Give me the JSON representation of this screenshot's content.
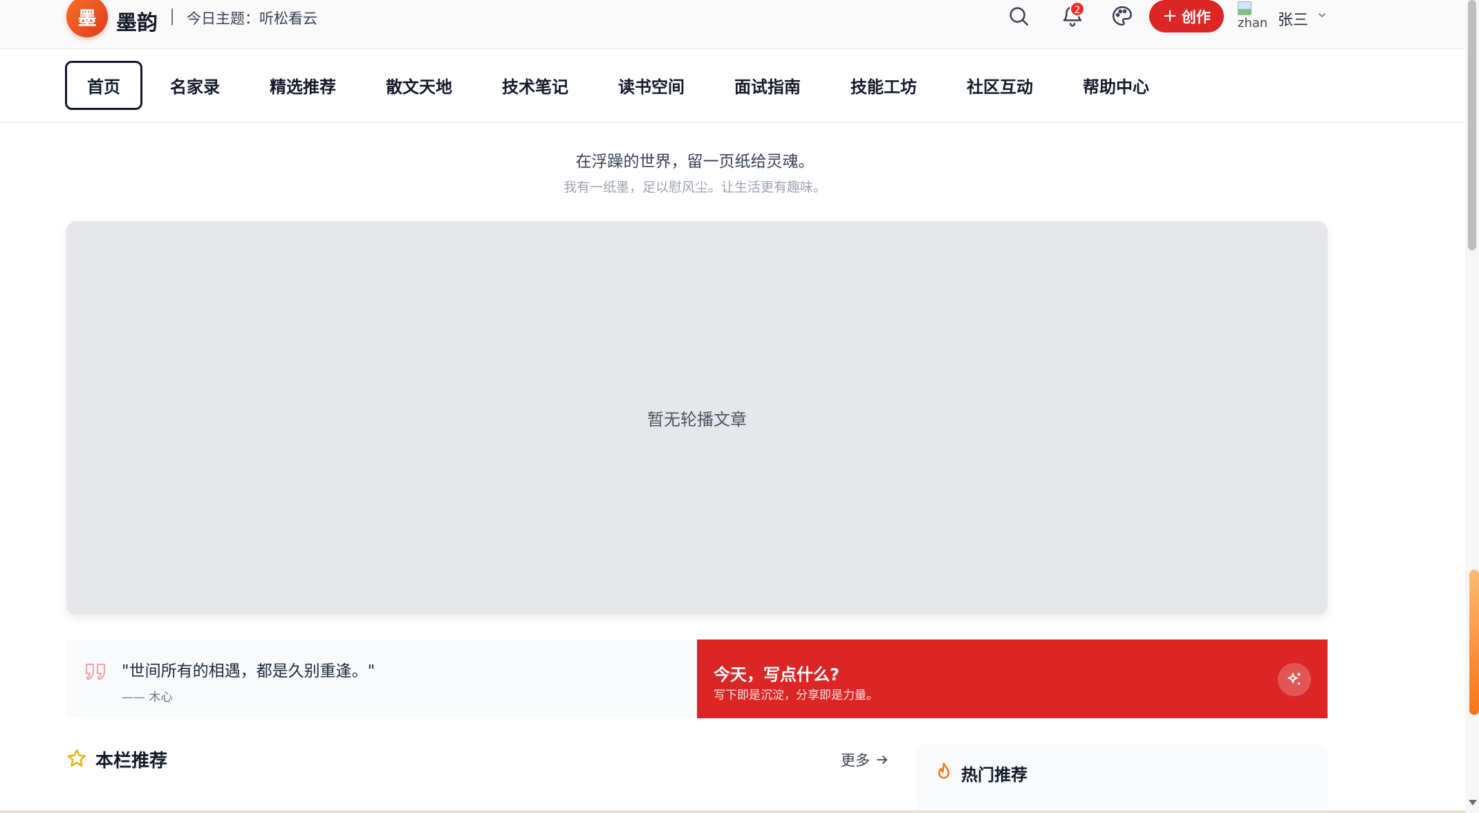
{
  "header": {
    "logo_char": "墨",
    "brand_name": "墨韵",
    "separator": "|",
    "theme_line": "今日主题：听松看云",
    "notification_count": "2",
    "create_label": "创作",
    "create_plus": "+",
    "avatar_alt": "zhan",
    "user_name": "张三"
  },
  "nav": {
    "items": [
      {
        "label": "首页",
        "active": true
      },
      {
        "label": "名家录"
      },
      {
        "label": "精选推荐"
      },
      {
        "label": "散文天地"
      },
      {
        "label": "技术笔记"
      },
      {
        "label": "读书空间"
      },
      {
        "label": "面试指南"
      },
      {
        "label": "技能工坊"
      },
      {
        "label": "社区互动"
      },
      {
        "label": "帮助中心"
      }
    ]
  },
  "hero": {
    "slogan": "在浮躁的世界，留一页纸给灵魂。",
    "subslogan": "我有一纸墨，足以慰风尘。让生活更有趣味。"
  },
  "carousel": {
    "empty_text": "暂无轮播文章"
  },
  "quote": {
    "text": "\"世间所有的相遇，都是久别重逢。\"",
    "author": "—— 木心"
  },
  "write_prompt": {
    "title": "今天，写点什么?",
    "subtitle": "写下即是沉淀，分享即是力量。"
  },
  "section": {
    "title": "本栏推荐",
    "more_label": "更多"
  },
  "hot": {
    "title": "热门推荐"
  },
  "colors": {
    "accent_red": "#dc2626",
    "logo_orange": "#f5722a",
    "star_yellow": "#eab308",
    "flame_orange": "#f97316"
  }
}
